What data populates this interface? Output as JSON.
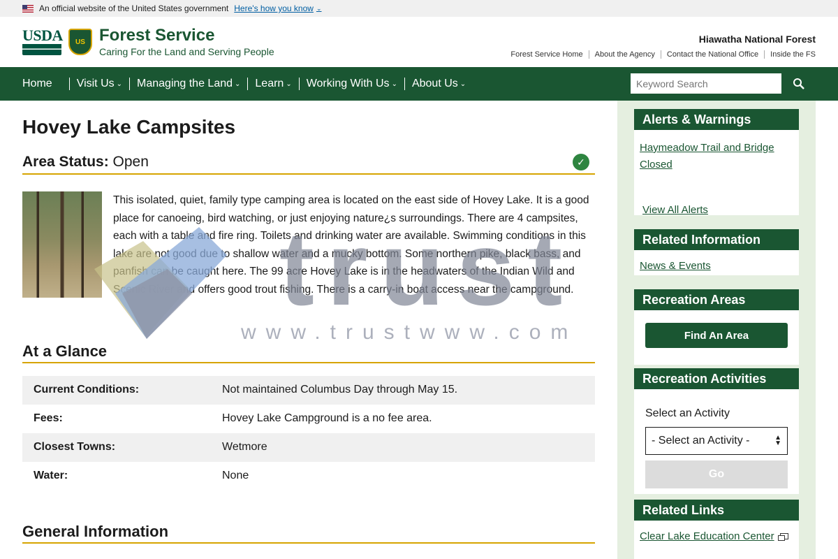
{
  "gov_banner": {
    "text": "An official website of the United States government",
    "link": "Here's how you know"
  },
  "header": {
    "usda": "USDA",
    "shield": "US",
    "title": "Forest Service",
    "tagline": "Caring For the Land and Serving People",
    "forest_name": "Hiawatha National Forest",
    "utility_links": [
      "Forest Service Home",
      "About the Agency",
      "Contact the National Office",
      "Inside the FS"
    ]
  },
  "nav": {
    "items": [
      "Home",
      "Visit Us",
      "Managing the Land",
      "Learn",
      "Working With Us",
      "About Us"
    ],
    "search_placeholder": "Keyword Search"
  },
  "main": {
    "title": "Hovey Lake Campsites",
    "status_label": "Area Status:",
    "status_value": "Open",
    "description": "This isolated, quiet, family type camping area is located on the east side of Hovey Lake. It is a good place for canoeing, bird watching, or just enjoying nature¿s surroundings. There are 4 campsites, each with a table and fire ring. Toilets and drinking water are available. Swimming conditions in this lake are not good due to shallow water and a mucky bottom. Some northern pike, black bass, and panfish can be caught here. The 99 acre Hovey Lake is in the headwaters of the Indian Wild and Scenic River and offers good trout fishing. There is a carry-in boat access near the campground.",
    "glance_heading": "At a Glance",
    "glance_rows": [
      {
        "key": "Current Conditions:",
        "value": "Not maintained Columbus Day through May 15."
      },
      {
        "key": "Fees:",
        "value": "Hovey Lake Campground is a no fee area."
      },
      {
        "key": "Closest Towns:",
        "value": "Wetmore"
      },
      {
        "key": "Water:",
        "value": "None"
      }
    ],
    "general_heading": "General Information"
  },
  "sidebar": {
    "alerts": {
      "heading": "Alerts & Warnings",
      "item": "Haymeadow Trail and Bridge Closed",
      "view_all": "View All Alerts"
    },
    "related_info": {
      "heading": "Related Information",
      "link": "News & Events"
    },
    "recreation_areas": {
      "heading": "Recreation Areas",
      "button": "Find An Area"
    },
    "recreation_activities": {
      "heading": "Recreation Activities",
      "label": "Select an Activity",
      "selected": "- Select an Activity -",
      "go": "Go"
    },
    "related_links": {
      "heading": "Related Links",
      "link": "Clear Lake Education Center"
    }
  },
  "watermark": {
    "word": "trust",
    "url": "www.trustwww.com"
  },
  "colors": {
    "brand_green": "#1a5632",
    "gold": "#d6a400",
    "sidebar_bg": "#e5efe0",
    "status_green": "#2e8540"
  }
}
